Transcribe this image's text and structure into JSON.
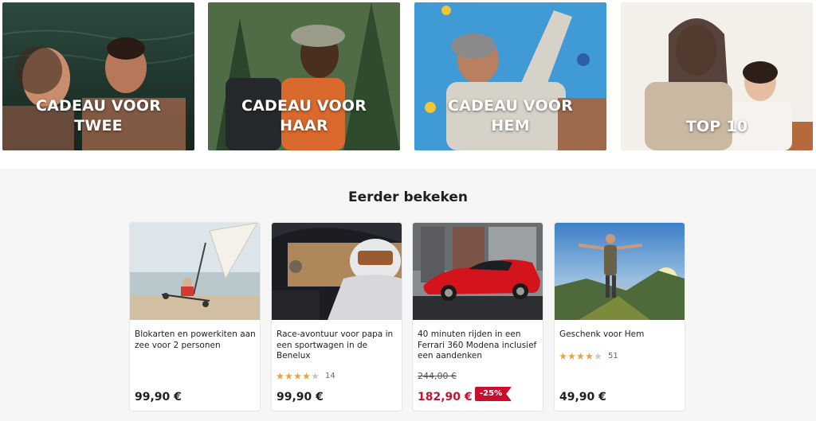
{
  "categories": [
    {
      "label_line1": "CADEAU VOOR",
      "label_line2": "TWEE"
    },
    {
      "label_line1": "CADEAU VOOR",
      "label_line2": "HAAR"
    },
    {
      "label_line1": "CADEAU VOOR",
      "label_line2": "HEM"
    },
    {
      "label": "TOP 10"
    }
  ],
  "recently_viewed": {
    "title": "Eerder bekeken",
    "products": [
      {
        "title": "Blokarten en powerkiten aan zee voor 2 personen",
        "price": "99,90 €"
      },
      {
        "title": "Race-avontuur voor papa in een sportwagen in de Benelux",
        "rating_stars": 4,
        "rating_count": "14",
        "price": "99,90 €"
      },
      {
        "title": "40 minuten rijden in een Ferrari 360 Modena inclusief een aandenken",
        "old_price": "244,00 €",
        "price": "182,90 €",
        "discount": "-25%"
      },
      {
        "title": "Geschenk voor Hem",
        "rating_stars": 4,
        "rating_count": "51",
        "price": "49,90 €"
      }
    ]
  },
  "colors": {
    "star": "#e8a33c",
    "star_empty": "#c8c8c8",
    "sale": "#c8102e"
  }
}
